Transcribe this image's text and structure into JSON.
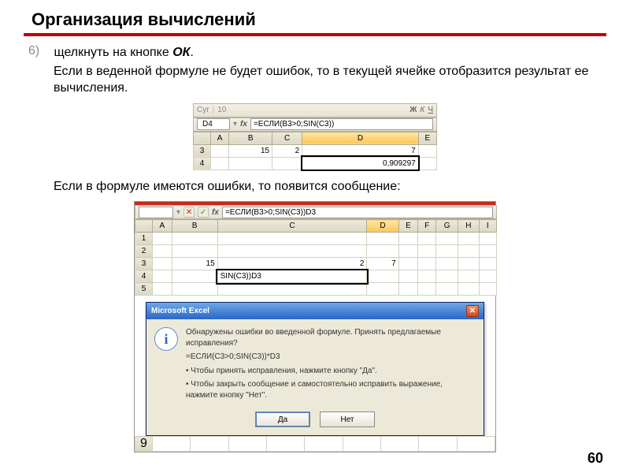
{
  "slide": {
    "title": "Организация вычислений",
    "step_number": "6)",
    "step_text_a": "щелкнуть на кнопке ",
    "step_text_ok": "ОК",
    "step_text_b": ".",
    "sub1": "Если в веденной формуле не будет ошибок, то в текущей ячейке отобразится результат ее вычисления.",
    "sub2": "Если в формуле имеются ошибки, то появится сообщение:",
    "page": "60"
  },
  "xl1": {
    "cellref": "D4",
    "fx": "fx",
    "formula": "=ЕСЛИ(B3>0;SIN(C3))",
    "cols": [
      "A",
      "B",
      "C",
      "D",
      "E"
    ],
    "row3": {
      "B": "15",
      "C": "2",
      "D": "7"
    },
    "row4": {
      "D": "0,909297"
    }
  },
  "xl2": {
    "x_icon": "✕",
    "check_icon": "✓",
    "fx": "fx",
    "formula": "=ЕСЛИ(B3>0;SIN(C3))D3",
    "cols": [
      "A",
      "B",
      "C",
      "D",
      "E",
      "F",
      "G",
      "H",
      "I"
    ],
    "row3": {
      "B": "15",
      "C": "2",
      "D": "7"
    },
    "row4": {
      "C": "SIN(C3))D3"
    }
  },
  "dialog": {
    "title": "Microsoft Excel",
    "line1": "Обнаружены ошибки во введенной формуле. Принять предлагаемые исправления?",
    "line2": "=ЕСЛИ(C3>0;SIN(C3))*D3",
    "bullet1": "• Чтобы принять исправления, нажмите кнопку \"Да\".",
    "bullet2": "• Чтобы закрыть сообщение и самостоятельно исправить выражение, нажмите кнопку \"Нет\".",
    "yes": "Да",
    "no": "Нет",
    "close": "✕"
  }
}
